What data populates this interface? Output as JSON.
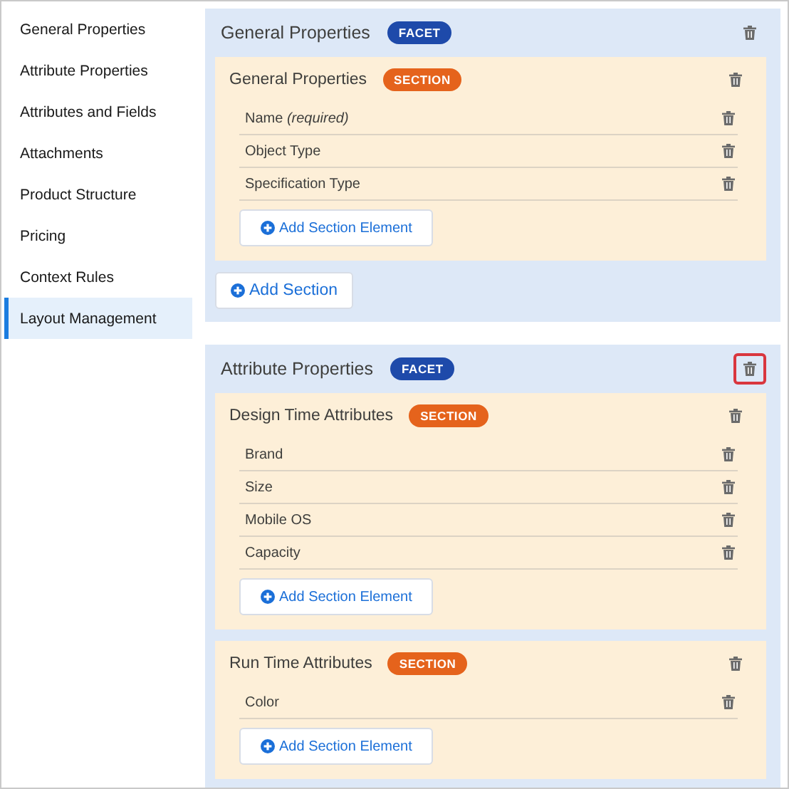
{
  "sidebar": {
    "items": [
      {
        "label": "General Properties",
        "selected": false
      },
      {
        "label": "Attribute Properties",
        "selected": false
      },
      {
        "label": "Attributes and Fields",
        "selected": false
      },
      {
        "label": "Attachments",
        "selected": false
      },
      {
        "label": "Product Structure",
        "selected": false
      },
      {
        "label": "Pricing",
        "selected": false
      },
      {
        "label": "Context Rules",
        "selected": false
      },
      {
        "label": "Layout Management",
        "selected": true
      }
    ]
  },
  "facets": [
    {
      "title": "General Properties",
      "badge": "FACET",
      "delete_highlighted": false,
      "add_section_label": "Add Section",
      "sections": [
        {
          "title": "General Properties",
          "badge": "SECTION",
          "elements": [
            "Name *(required)*",
            "Object Type",
            "Specification Type"
          ],
          "add_element_label": "Add Section Element"
        }
      ]
    },
    {
      "title": "Attribute Properties",
      "badge": "FACET",
      "delete_highlighted": true,
      "sections": [
        {
          "title": "Design Time Attributes",
          "badge": "SECTION",
          "elements": [
            "Brand",
            "Size",
            "Mobile OS",
            "Capacity"
          ],
          "add_element_label": "Add Section Element"
        },
        {
          "title": "Run Time Attributes",
          "badge": "SECTION",
          "elements": [
            "Color"
          ],
          "add_element_label": "Add Section Element"
        }
      ]
    }
  ]
}
